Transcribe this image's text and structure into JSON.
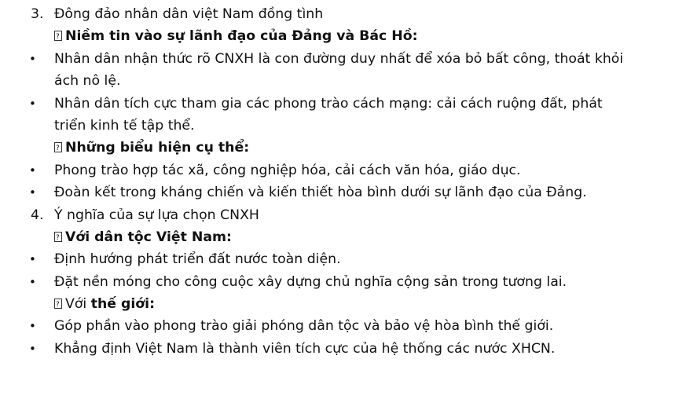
{
  "items": [
    {
      "type": "numbered",
      "number": "3.",
      "text": "Đông đảo nhân dân việt Nam đồng tình"
    },
    {
      "type": "subheading",
      "prefix": "",
      "text": "Niềm tin vào sự lãnh đạo của Đảng và Bác Hồ:"
    },
    {
      "type": "bullet",
      "text": "Nhân dân nhận thức rõ CNXH là con đường duy nhất để xóa bỏ bất công, thoát khỏi"
    },
    {
      "type": "continuation",
      "text": "ách nô lệ."
    },
    {
      "type": "bullet",
      "text": "Nhân dân tích cực tham gia các phong trào cách mạng: cải cách ruộng đất, phát"
    },
    {
      "type": "continuation",
      "text": "triển kinh tế tập thể."
    },
    {
      "type": "subheading",
      "prefix": "",
      "text": "Những biểu hiện cụ thể:"
    },
    {
      "type": "bullet",
      "text": "Phong trào hợp tác xã, công nghiệp hóa, cải cách văn hóa, giáo dục."
    },
    {
      "type": "bullet",
      "text": "Đoàn kết trong kháng chiến và kiến thiết hòa bình dưới sự lãnh đạo của Đảng."
    },
    {
      "type": "numbered",
      "number": "4.",
      "text": "Ý nghĩa của sự lựa chọn CNXH"
    },
    {
      "type": "subheading",
      "prefix": "",
      "text": "Với dân tộc Việt Nam:"
    },
    {
      "type": "bullet",
      "text": "Định hướng phát triển đất nước toàn diện."
    },
    {
      "type": "bullet",
      "text": "Đặt nền móng cho công cuộc xây dựng chủ nghĩa cộng sản trong tương lai."
    },
    {
      "type": "subheading",
      "prefix": "Với ",
      "text": "thế giới:"
    },
    {
      "type": "bullet",
      "text": "Góp phần vào phong trào giải phóng dân tộc và bảo vệ hòa bình thế giới."
    },
    {
      "type": "bullet",
      "text": "Khẳng định Việt Nam là thành viên tích cực của hệ thống các nước XHCN."
    }
  ],
  "bullet_glyph": "•",
  "missing_glyph_icon": "unknown-character-box-icon"
}
